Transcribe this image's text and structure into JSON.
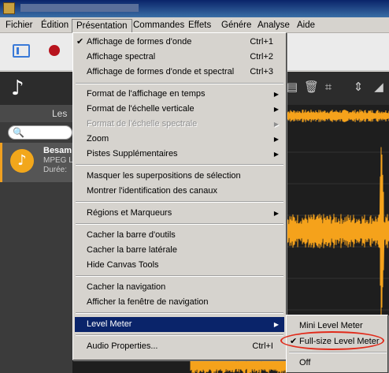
{
  "menubar": {
    "items": [
      "Fichier",
      "Édition",
      "Présentation",
      "Commandes",
      "Effets",
      "Génére",
      "Analyse",
      "Aide"
    ]
  },
  "left_panel": {
    "search": {
      "placeholder": ""
    },
    "header_label": "Les",
    "file": {
      "name": "Besam",
      "format": "MPEG L",
      "duration": "Durée:"
    }
  },
  "menu": {
    "items": [
      {
        "label": "Affichage de formes d'onde",
        "shortcut": "Ctrl+1",
        "checked": true
      },
      {
        "label": "Affichage spectral",
        "shortcut": "Ctrl+2"
      },
      {
        "label": "Affichage de formes d'onde et spectral",
        "shortcut": "Ctrl+3"
      },
      {
        "label": "Format de l'affichage en temps",
        "submenu": true
      },
      {
        "label": "Format de l'échelle verticale",
        "submenu": true
      },
      {
        "label": "Format de l'échelle spectrale",
        "submenu": true,
        "disabled": true
      },
      {
        "label": "Zoom",
        "submenu": true
      },
      {
        "label": "Pistes Supplémentaires",
        "submenu": true
      },
      {
        "label": "Masquer les superpositions de sélection"
      },
      {
        "label": "Montrer l'identification des canaux"
      },
      {
        "label": "Régions et Marqueurs",
        "submenu": true
      },
      {
        "label": "Cacher la barre d'outils"
      },
      {
        "label": "Cacher la barre latérale"
      },
      {
        "label": "Hide Canvas Tools"
      },
      {
        "label": "Cacher la navigation"
      },
      {
        "label": "Afficher la fenêtre de navigation"
      },
      {
        "label": "Level Meter",
        "submenu": true,
        "highlighted": true
      },
      {
        "label": "Audio Properties...",
        "shortcut": "Ctrl+I"
      }
    ]
  },
  "submenu": {
    "items": [
      {
        "label": "Mini Level Meter"
      },
      {
        "label": "Full-size Level Meter",
        "checked": true
      },
      {
        "label": "Off"
      }
    ]
  },
  "icons": {
    "check": "✔",
    "arrow": "▶",
    "note": "♪",
    "search": "🔍"
  },
  "colors": {
    "highlight": "#0a246a",
    "waveform": "#f5a21b",
    "annotation": "#e12a1a",
    "accent": "#3a7ad8",
    "record": "#b8141e"
  }
}
